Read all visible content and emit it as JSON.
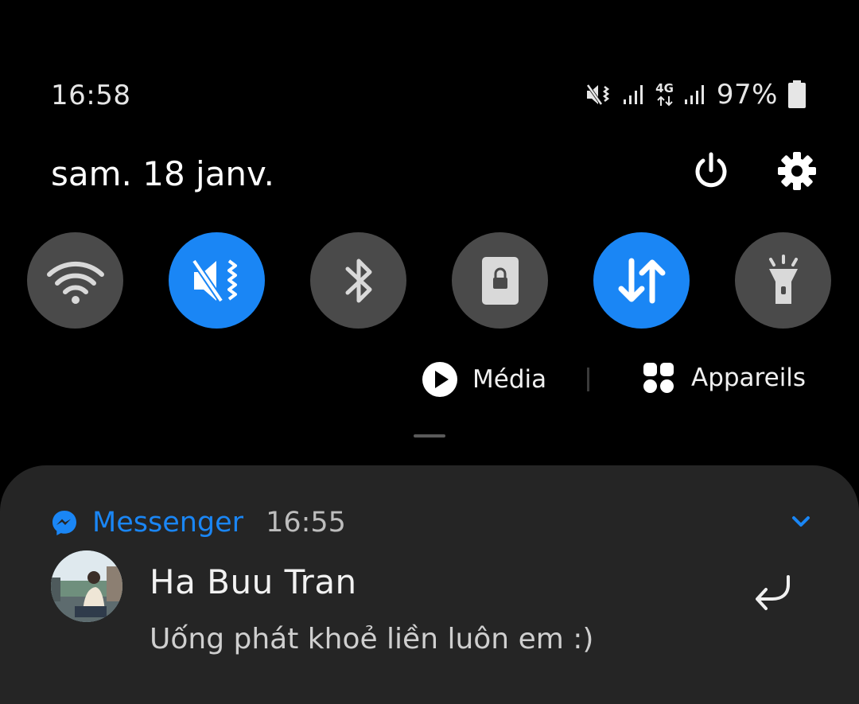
{
  "status_bar": {
    "time": "16:58",
    "network_type": "4G",
    "battery": "97%",
    "icons": [
      "vibrate-icon",
      "signal-icon",
      "network-4g-icon",
      "signal-icon",
      "battery-icon"
    ]
  },
  "header": {
    "date": "sam. 18 janv.",
    "icons": [
      "power-icon",
      "settings-gear-icon"
    ]
  },
  "quick_settings": {
    "tiles": [
      {
        "name": "wifi",
        "icon": "wifi-icon",
        "active": false
      },
      {
        "name": "vibrate",
        "icon": "vibrate-icon",
        "active": true
      },
      {
        "name": "bluetooth",
        "icon": "bluetooth-icon",
        "active": false
      },
      {
        "name": "rotation-lock",
        "icon": "rotation-lock-icon",
        "active": false
      },
      {
        "name": "mobile-data",
        "icon": "mobile-data-icon",
        "active": true
      },
      {
        "name": "flashlight",
        "icon": "flashlight-icon",
        "active": false
      }
    ]
  },
  "media_bar": {
    "media_label": "Média",
    "devices_label": "Appareils",
    "icons": [
      "play-icon",
      "devices-grid-icon"
    ]
  },
  "notification": {
    "app_name": "Messenger",
    "time": "16:55",
    "sender": "Ha Buu Tran",
    "message": "Uống phát khoẻ liền luôn em :)",
    "icons": [
      "messenger-icon",
      "chevron-down-icon",
      "reply-icon"
    ]
  },
  "colors": {
    "background": "#000000",
    "tile_inactive": "#4a4a4a",
    "tile_active": "#1a86f5",
    "card_background": "#252525",
    "accent": "#1a86f5"
  }
}
